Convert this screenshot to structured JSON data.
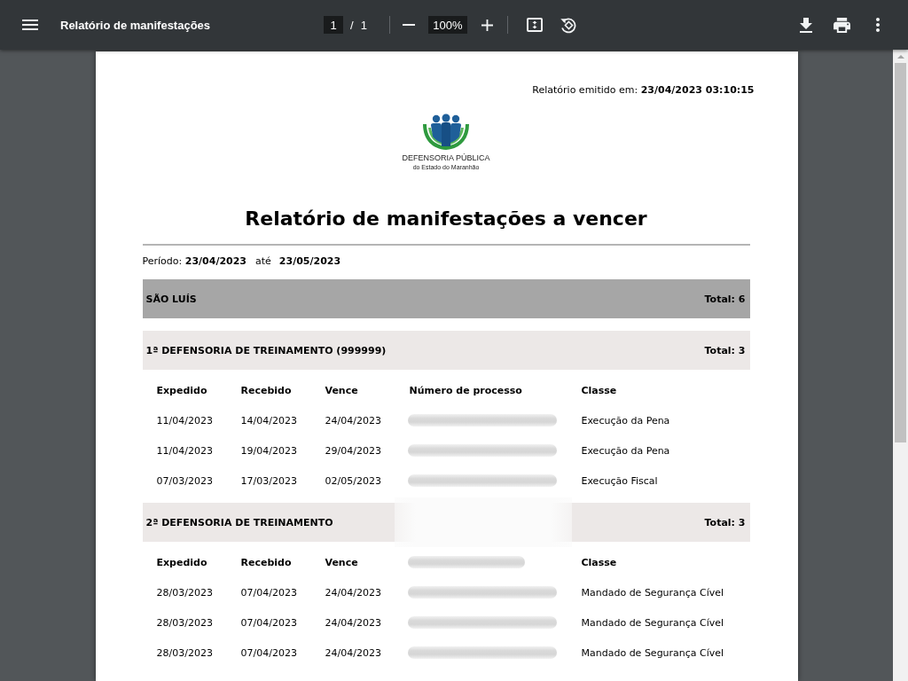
{
  "toolbar": {
    "title": "Relatório de manifestações",
    "page_number": "1",
    "page_separator": "/",
    "page_count": "1",
    "zoom": "100%"
  },
  "report": {
    "issued": {
      "label": "Relatório emitido em:",
      "value": "23/04/2023 03:10:15"
    },
    "logo": {
      "name": "DEFENSORIA PÚBLICA",
      "subtitle": "do Estado do Maranhão"
    },
    "title": "Relatório de manifestações a vencer",
    "period": {
      "label": "Período:",
      "start": "23/04/2023",
      "separator": "até",
      "end": "23/05/2023"
    }
  },
  "regions": [
    {
      "name": "SÃO LUÍS",
      "total": "Total: 6",
      "offices": [
        {
          "name": "1ª DEFENSORIA DE TREINAMENTO (999999)",
          "total": "Total: 3",
          "columns": [
            {
              "kind": "text",
              "label": "Expedido"
            },
            {
              "kind": "text",
              "label": "Recebido"
            },
            {
              "kind": "text",
              "label": "Vence"
            },
            {
              "kind": "text",
              "label": "Número de processo"
            },
            {
              "kind": "text",
              "label": "Classe"
            }
          ],
          "rows": [
            [
              {
                "kind": "text",
                "text": "11/04/2023"
              },
              {
                "kind": "text",
                "text": "14/04/2023"
              },
              {
                "kind": "text",
                "text": "24/04/2023"
              },
              {
                "kind": "redacted"
              },
              {
                "kind": "text",
                "text": "Execução da Pena"
              }
            ],
            [
              {
                "kind": "text",
                "text": "11/04/2023"
              },
              {
                "kind": "text",
                "text": "19/04/2023"
              },
              {
                "kind": "text",
                "text": "29/04/2023"
              },
              {
                "kind": "redacted"
              },
              {
                "kind": "text",
                "text": "Execução da Pena"
              }
            ],
            [
              {
                "kind": "text",
                "text": "07/03/2023"
              },
              {
                "kind": "text",
                "text": "17/03/2023"
              },
              {
                "kind": "text",
                "text": "02/05/2023"
              },
              {
                "kind": "redacted"
              },
              {
                "kind": "text",
                "text": "Execução Fiscal"
              }
            ]
          ]
        },
        {
          "name": "2ª DEFENSORIA DE TREINAMENTO",
          "total": "Total: 3",
          "columns": [
            {
              "kind": "text",
              "label": "Expedido"
            },
            {
              "kind": "text",
              "label": "Recebido"
            },
            {
              "kind": "text",
              "label": "Vence"
            },
            {
              "kind": "redacted"
            },
            {
              "kind": "text",
              "label": "Classe"
            }
          ],
          "rows": [
            [
              {
                "kind": "text",
                "text": "28/03/2023"
              },
              {
                "kind": "text",
                "text": "07/04/2023"
              },
              {
                "kind": "text",
                "text": "24/04/2023"
              },
              {
                "kind": "redacted"
              },
              {
                "kind": "text",
                "text": "Mandado de Segurança Cível"
              }
            ],
            [
              {
                "kind": "text",
                "text": "28/03/2023"
              },
              {
                "kind": "text",
                "text": "07/04/2023"
              },
              {
                "kind": "text",
                "text": "24/04/2023"
              },
              {
                "kind": "redacted"
              },
              {
                "kind": "text",
                "text": "Mandado de Segurança Cível"
              }
            ],
            [
              {
                "kind": "text",
                "text": "28/03/2023"
              },
              {
                "kind": "text",
                "text": "07/04/2023"
              },
              {
                "kind": "text",
                "text": "24/04/2023"
              },
              {
                "kind": "redacted"
              },
              {
                "kind": "text",
                "text": "Mandado de Segurança Cível"
              }
            ]
          ]
        }
      ]
    }
  ]
}
